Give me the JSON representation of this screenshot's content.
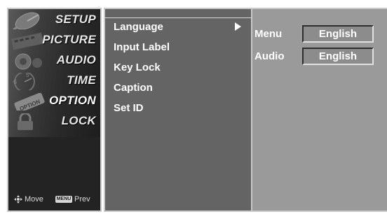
{
  "categories": [
    {
      "label": "SETUP",
      "icon": "satellite-dish-icon"
    },
    {
      "label": "PICTURE",
      "icon": "film-strip-icon"
    },
    {
      "label": "AUDIO",
      "icon": "speaker-icon"
    },
    {
      "label": "TIME",
      "icon": "clock-icon"
    },
    {
      "label": "OPTION",
      "icon": "option-tag-icon"
    },
    {
      "label": "LOCK",
      "icon": "lock-icon"
    }
  ],
  "selected_category": "OPTION",
  "hints": {
    "move_label": "Move",
    "menu_key": "MENU",
    "prev_label": "Prev"
  },
  "submenu": [
    {
      "label": "Language",
      "has_arrow": true,
      "selected": true
    },
    {
      "label": "Input Label",
      "has_arrow": false
    },
    {
      "label": "Key Lock",
      "has_arrow": false
    },
    {
      "label": "Caption",
      "has_arrow": false
    },
    {
      "label": "Set ID",
      "has_arrow": false
    }
  ],
  "settings": [
    {
      "label": "Menu",
      "value": "English"
    },
    {
      "label": "Audio",
      "value": "English"
    }
  ],
  "colors": {
    "left_panel_bg": "#2b2b2b",
    "middle_panel_bg": "#646464",
    "right_panel_bg": "#9a9a9a",
    "border": "#c9c9c9",
    "text": "#ffffff"
  }
}
